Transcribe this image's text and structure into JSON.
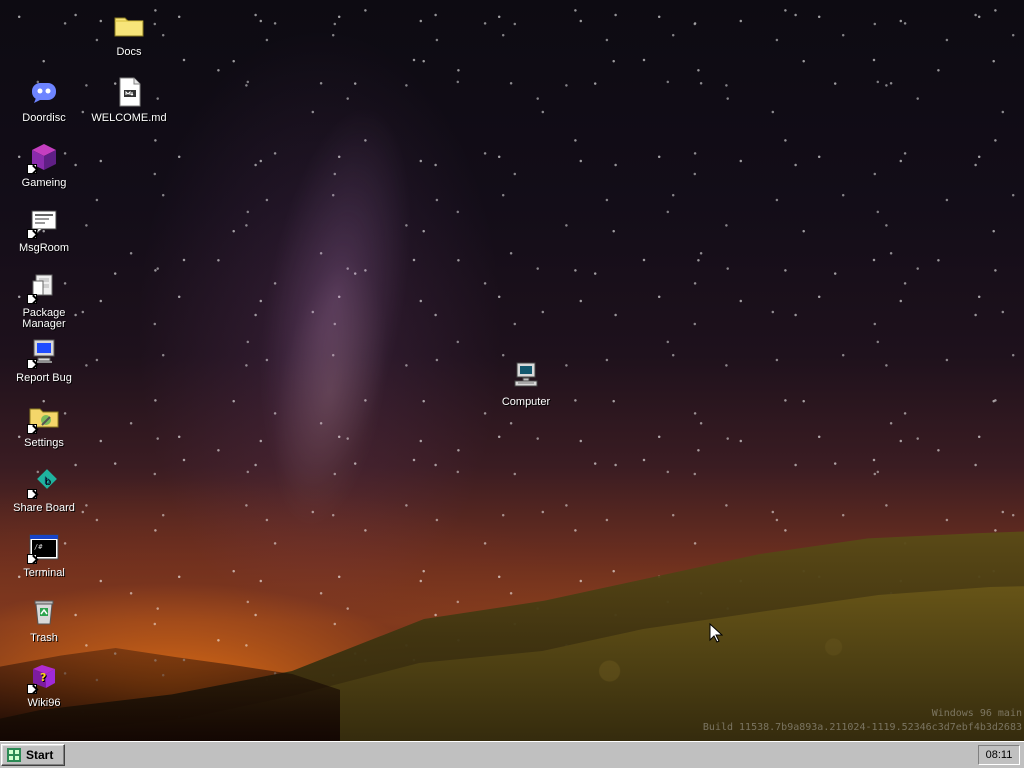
{
  "desktop": {
    "icons": [
      {
        "label": "Docs"
      },
      {
        "label": "Doordisc"
      },
      {
        "label": "WELCOME.md"
      },
      {
        "label": "Gameing"
      },
      {
        "label": "MsgRoom"
      },
      {
        "label": "Package Manager"
      },
      {
        "label": "Report Bug"
      },
      {
        "label": "Settings"
      },
      {
        "label": "Share Board"
      },
      {
        "label": "Terminal"
      },
      {
        "label": "Trash"
      },
      {
        "label": "Wiki96"
      },
      {
        "label": "Computer"
      }
    ],
    "watermark": {
      "line1": "Windows 96 main",
      "line2": "Build 11538.7b9a893a.211024-1119.52346c3d7ebf4b3d2683"
    }
  },
  "taskbar": {
    "start_label": "Start",
    "clock": "08:11"
  }
}
